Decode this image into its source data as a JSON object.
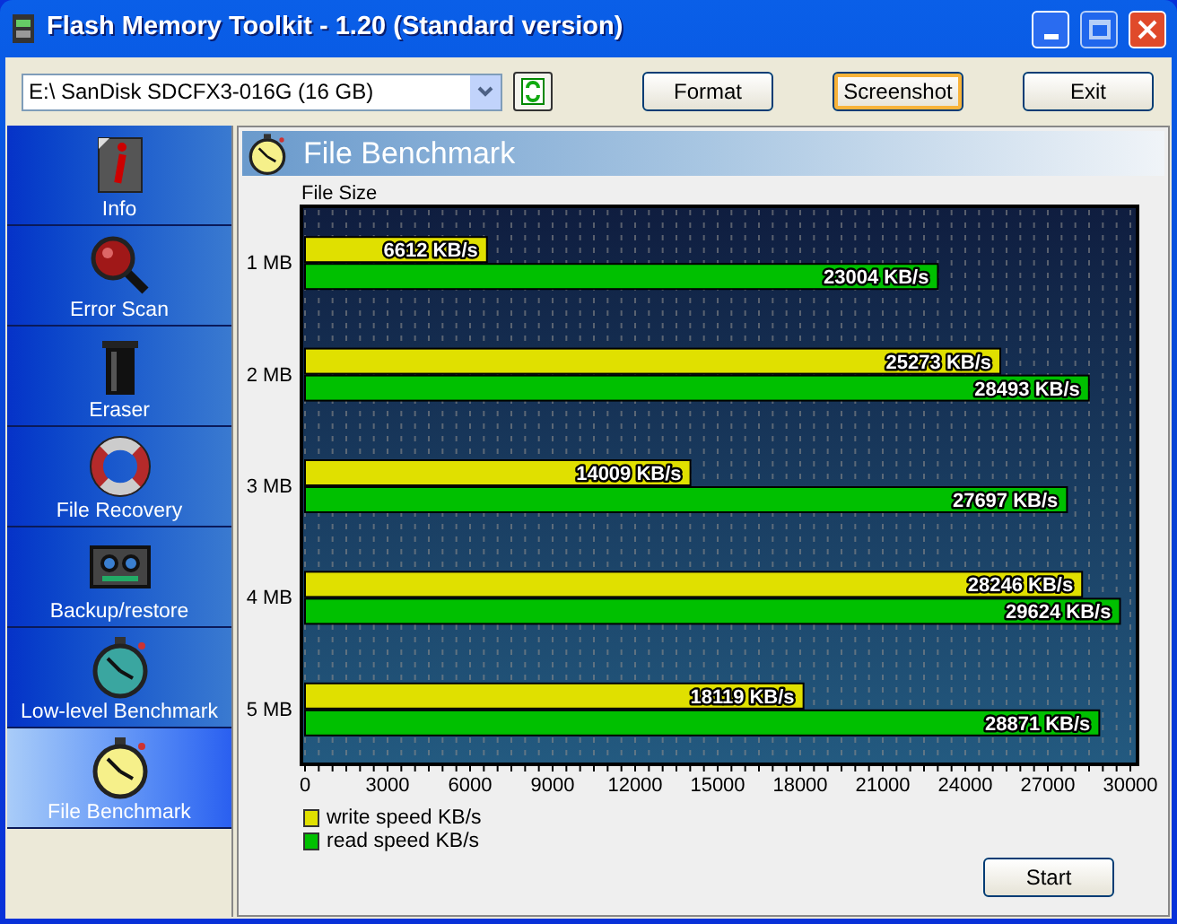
{
  "window": {
    "title": "Flash Memory Toolkit - 1.20 (Standard version)"
  },
  "toolbar": {
    "drive": "E:\\ SanDisk SDCFX3-016G (16 GB)",
    "buttons": [
      {
        "label": "Format",
        "focused": false
      },
      {
        "label": "Screenshot",
        "focused": true
      },
      {
        "label": "Exit",
        "focused": false
      }
    ]
  },
  "sidebar": {
    "items": [
      {
        "label": "Info",
        "selected": false
      },
      {
        "label": "Error Scan",
        "selected": false
      },
      {
        "label": "Eraser",
        "selected": false
      },
      {
        "label": "File Recovery",
        "selected": false
      },
      {
        "label": "Backup/restore",
        "selected": false
      },
      {
        "label": "Low-level Benchmark",
        "selected": false
      },
      {
        "label": "File Benchmark",
        "selected": true
      }
    ]
  },
  "panel": {
    "title": "File Benchmark",
    "chart_data": {
      "type": "bar",
      "orientation": "horizontal",
      "ylabel": "File Size",
      "categories": [
        "1 MB",
        "2 MB",
        "3 MB",
        "4 MB",
        "5 MB"
      ],
      "series": [
        {
          "name": "write speed KB/s",
          "color": "#e0e000",
          "values": [
            6612,
            25273,
            14009,
            28246,
            18119
          ]
        },
        {
          "name": "read speed KB/s",
          "color": "#00c000",
          "values": [
            23004,
            28493,
            27697,
            29624,
            28871
          ]
        }
      ],
      "value_labels": [
        [
          "6612 KB/s",
          "25273 KB/s",
          "14009 KB/s",
          "28246 KB/s",
          "18119 KB/s"
        ],
        [
          "23004 KB/s",
          "28493 KB/s",
          "27697 KB/s",
          "29624 KB/s",
          "28871 KB/s"
        ]
      ],
      "xlim": [
        0,
        30000
      ],
      "grid": true,
      "xticks": [
        0,
        3000,
        6000,
        9000,
        12000,
        15000,
        18000,
        21000,
        24000,
        27000,
        30000
      ]
    },
    "start_button": "Start"
  }
}
